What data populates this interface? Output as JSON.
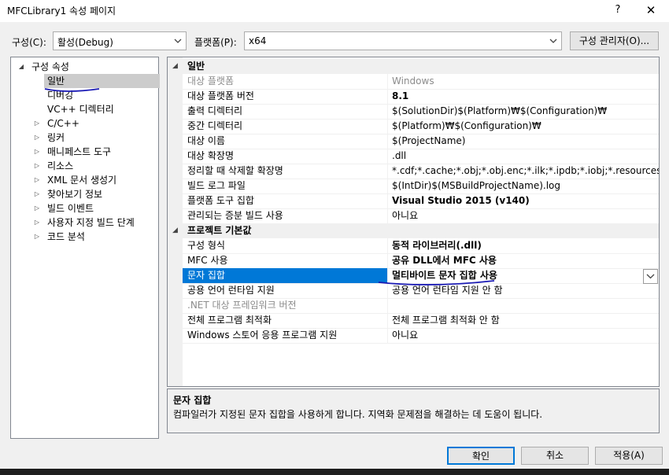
{
  "window": {
    "title": "MFCLibrary1 속성 페이지",
    "help": "?",
    "close": "✕"
  },
  "toolbar": {
    "config_label": "구성(C):",
    "config_value": "활성(Debug)",
    "platform_label": "플랫폼(P):",
    "platform_value": "x64",
    "manager_button": "구성 관리자(O)..."
  },
  "tree": {
    "root": "구성 속성",
    "items": [
      {
        "label": "일반",
        "expandable": false,
        "selected": true
      },
      {
        "label": "디버깅",
        "expandable": false
      },
      {
        "label": "VC++ 디렉터리",
        "expandable": false
      },
      {
        "label": "C/C++",
        "expandable": true
      },
      {
        "label": "링커",
        "expandable": true
      },
      {
        "label": "매니페스트 도구",
        "expandable": true
      },
      {
        "label": "리소스",
        "expandable": true
      },
      {
        "label": "XML 문서 생성기",
        "expandable": true
      },
      {
        "label": "찾아보기 정보",
        "expandable": true
      },
      {
        "label": "빌드 이벤트",
        "expandable": true
      },
      {
        "label": "사용자 지정 빌드 단계",
        "expandable": true
      },
      {
        "label": "코드 분석",
        "expandable": true
      }
    ]
  },
  "grid": {
    "cat1": "일반",
    "rows1": [
      {
        "name": "대상 플랫폼",
        "value": "Windows",
        "gray": true
      },
      {
        "name": "대상 플랫폼 버전",
        "value": "8.1",
        "bold": true
      },
      {
        "name": "출력 디렉터리",
        "value": "$(SolutionDir)$(Platform)₩$(Configuration)₩"
      },
      {
        "name": "중간 디렉터리",
        "value": "$(Platform)₩$(Configuration)₩"
      },
      {
        "name": "대상 이름",
        "value": "$(ProjectName)"
      },
      {
        "name": "대상 확장명",
        "value": ".dll"
      },
      {
        "name": "정리할 때 삭제할 확장명",
        "value": "*.cdf;*.cache;*.obj;*.obj.enc;*.ilk;*.ipdb;*.iobj;*.resources;*.tlb;*.tli;*.tl"
      },
      {
        "name": "빌드 로그 파일",
        "value": "$(IntDir)$(MSBuildProjectName).log"
      },
      {
        "name": "플랫폼 도구 집합",
        "value": "Visual Studio 2015 (v140)",
        "bold": true
      },
      {
        "name": "관리되는 증분 빌드 사용",
        "value": "아니요"
      }
    ],
    "cat2": "프로젝트 기본값",
    "rows2": [
      {
        "name": "구성 형식",
        "value": "동적 라이브러리(.dll)",
        "bold": true
      },
      {
        "name": "MFC 사용",
        "value": "공유 DLL에서 MFC 사용",
        "bold": true
      },
      {
        "name": "문자 집합",
        "value": "멀티바이트 문자 집합 사용",
        "bold": true,
        "selected": true
      },
      {
        "name": "공용 언어 런타임 지원",
        "value": "공용 언어 런타임 지원 안 함"
      },
      {
        "name": ".NET 대상 프레임워크 버전",
        "value": "",
        "gray": true
      },
      {
        "name": "전체 프로그램 최적화",
        "value": "전체 프로그램 최적화 안 함"
      },
      {
        "name": "Windows 스토어 응용 프로그램 지원",
        "value": "아니요"
      }
    ]
  },
  "description": {
    "title": "문자 집합",
    "text": "컴파일러가 지정된 문자 집합을 사용하게 합니다. 지역화 문제점을 해결하는 데 도움이 됩니다."
  },
  "buttons": {
    "ok": "확인",
    "cancel": "취소",
    "apply": "적용(A)"
  },
  "colors": {
    "selection": "#0078d7",
    "annotation_ink": "#1a1ab4"
  }
}
